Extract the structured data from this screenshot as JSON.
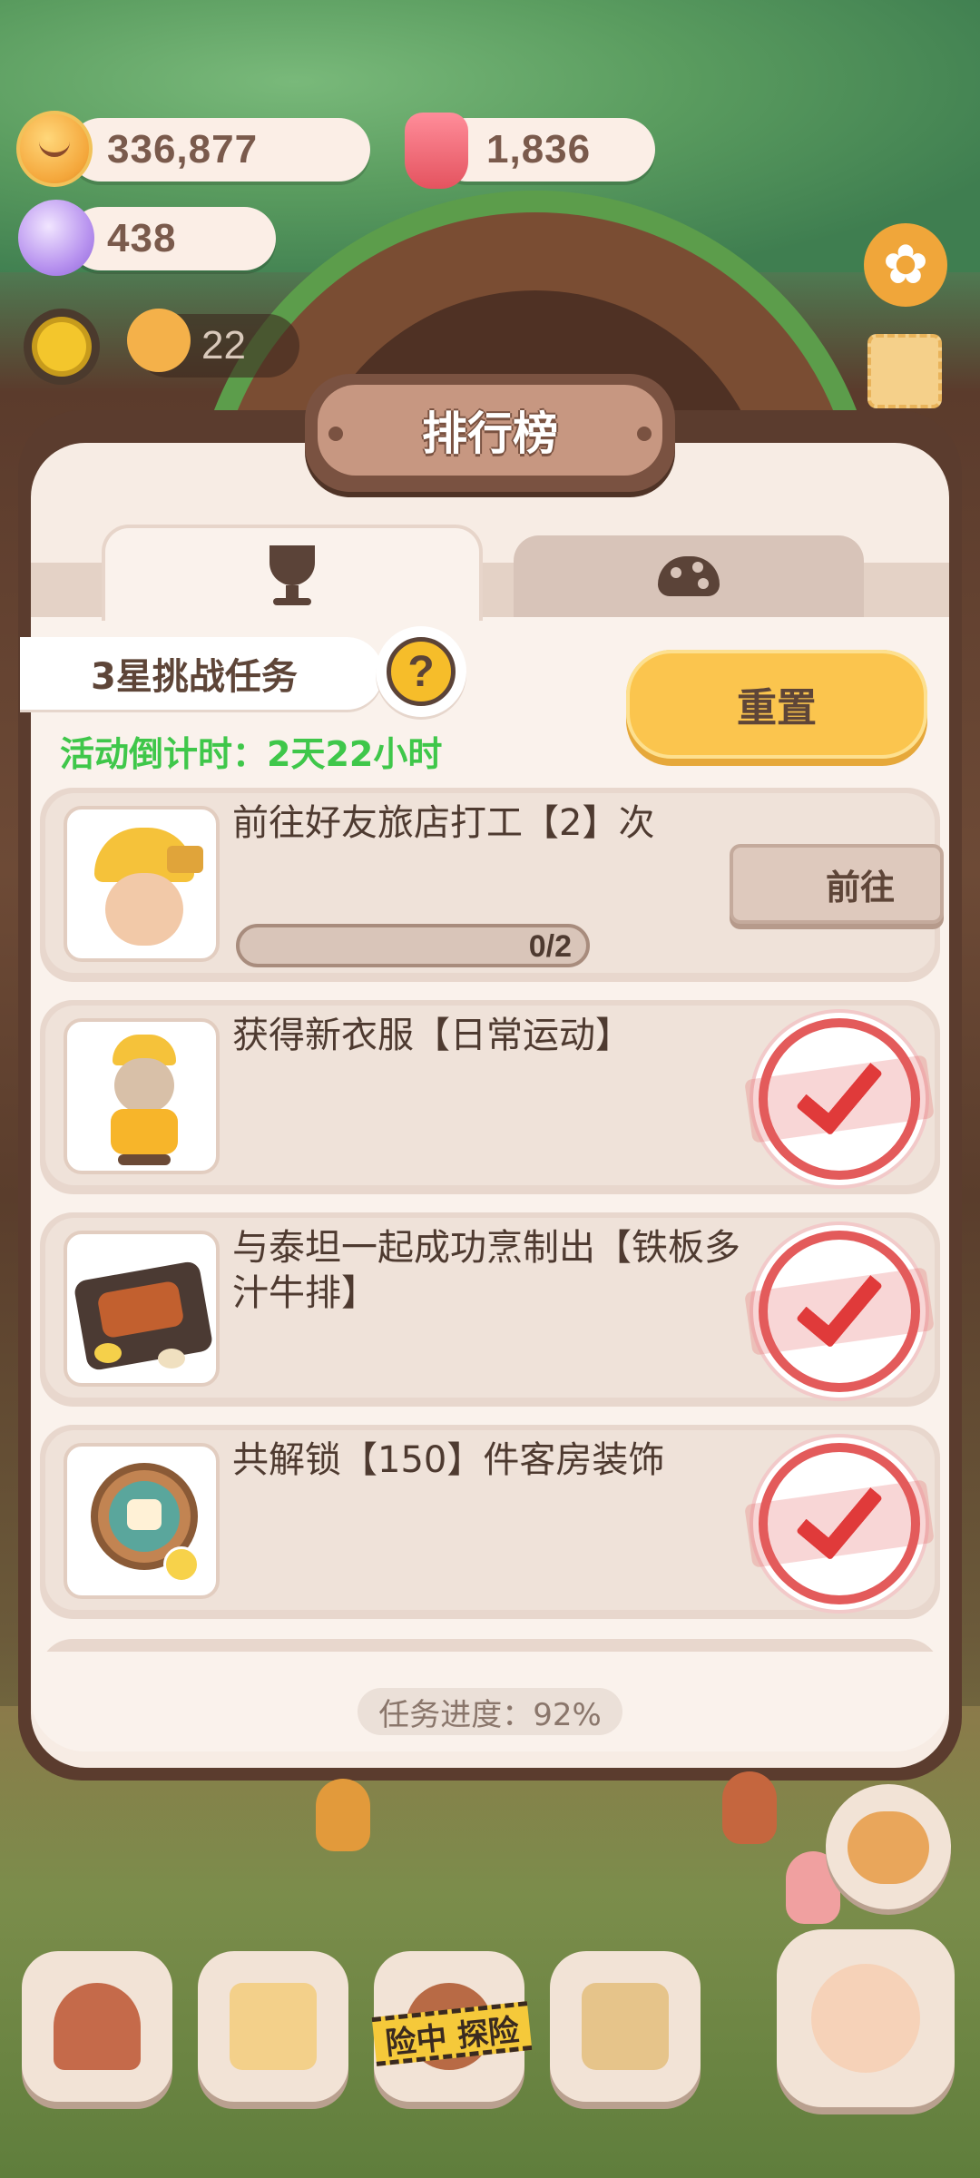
{
  "resources": {
    "coins": "336,877",
    "candles": "1,836",
    "gems": "438"
  },
  "hud": {
    "level_count": "22"
  },
  "panel": {
    "title": "排行榜",
    "tabs": [
      {
        "icon": "trophy-icon",
        "active": true
      },
      {
        "icon": "mushroom-icon",
        "active": false
      }
    ],
    "challenge_label": "3星挑战任务",
    "help_label": "?",
    "countdown": "活动倒计时：2天22小时",
    "reset_label": "重置",
    "tasks": [
      {
        "title": "前往好友旅店打工【2】次",
        "progress_text": "0/2",
        "progress": 0,
        "action_label": "前往",
        "completed": false,
        "thumb": "worker-character-icon"
      },
      {
        "title": "获得新衣服【日常运动】",
        "completed": true,
        "thumb": "sport-outfit-icon"
      },
      {
        "title": "与泰坦一起成功烹制出【铁板多汁牛排】",
        "completed": true,
        "thumb": "steak-plate-icon"
      },
      {
        "title": "共解锁【150】件客房装饰",
        "completed": true,
        "thumb": "room-decor-icon"
      }
    ],
    "overall_progress": "任务进度：92%"
  },
  "nav": {
    "items": [
      {
        "name": "mushroom-house-icon"
      },
      {
        "name": "notebook-icon"
      },
      {
        "name": "adventure-icon",
        "tape_label": "险中 探险"
      },
      {
        "name": "shop-stall-icon"
      },
      {
        "name": "character-alarm-icon"
      }
    ]
  },
  "colors": {
    "accent_yellow": "#fbc54e",
    "countdown_green": "#3fc74a",
    "stamp_red": "#e35b5b",
    "panel_brown": "#5b3c2e",
    "panel_bg": "#f7ece4"
  }
}
